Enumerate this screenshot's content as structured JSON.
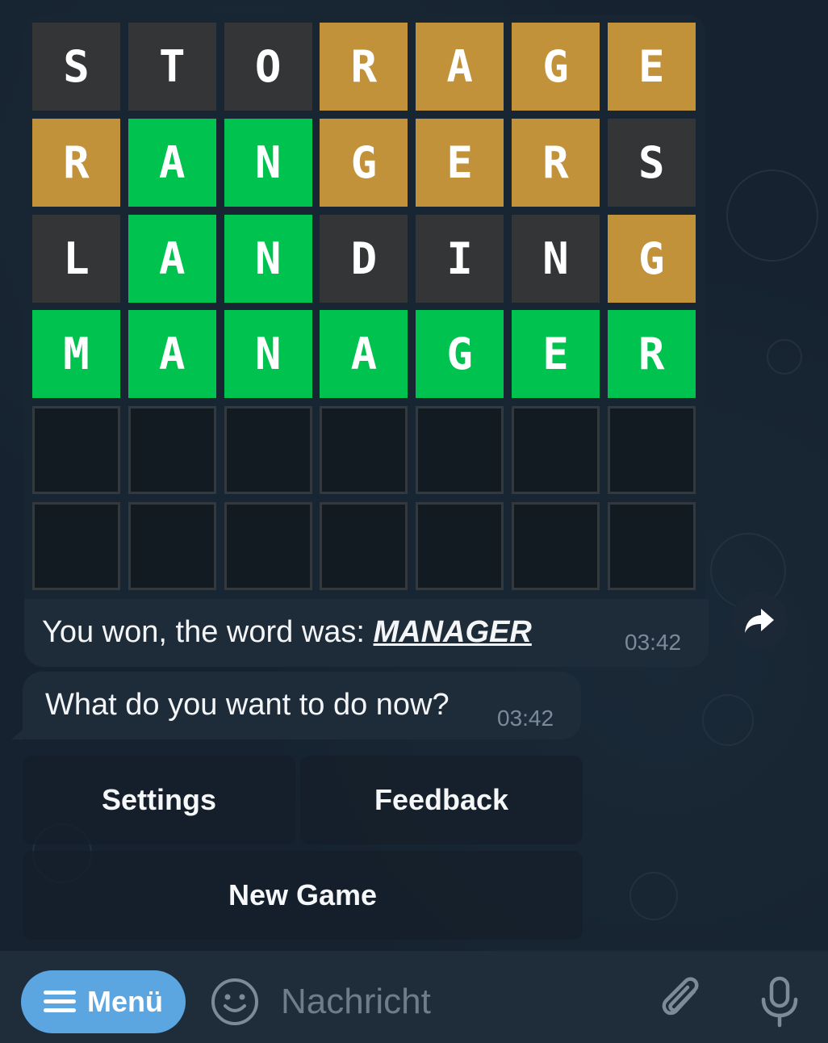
{
  "board": {
    "rows": [
      [
        {
          "l": "S",
          "s": "absent"
        },
        {
          "l": "T",
          "s": "absent"
        },
        {
          "l": "O",
          "s": "absent"
        },
        {
          "l": "R",
          "s": "present"
        },
        {
          "l": "A",
          "s": "present"
        },
        {
          "l": "G",
          "s": "present"
        },
        {
          "l": "E",
          "s": "present"
        }
      ],
      [
        {
          "l": "R",
          "s": "present"
        },
        {
          "l": "A",
          "s": "correct"
        },
        {
          "l": "N",
          "s": "correct"
        },
        {
          "l": "G",
          "s": "present"
        },
        {
          "l": "E",
          "s": "present"
        },
        {
          "l": "R",
          "s": "present"
        },
        {
          "l": "S",
          "s": "absent"
        }
      ],
      [
        {
          "l": "L",
          "s": "absent"
        },
        {
          "l": "A",
          "s": "correct"
        },
        {
          "l": "N",
          "s": "correct"
        },
        {
          "l": "D",
          "s": "absent"
        },
        {
          "l": "I",
          "s": "absent"
        },
        {
          "l": "N",
          "s": "absent"
        },
        {
          "l": "G",
          "s": "present"
        }
      ],
      [
        {
          "l": "M",
          "s": "correct"
        },
        {
          "l": "A",
          "s": "correct"
        },
        {
          "l": "N",
          "s": "correct"
        },
        {
          "l": "A",
          "s": "correct"
        },
        {
          "l": "G",
          "s": "correct"
        },
        {
          "l": "E",
          "s": "correct"
        },
        {
          "l": "R",
          "s": "correct"
        }
      ],
      [
        {
          "l": "",
          "s": "empty"
        },
        {
          "l": "",
          "s": "empty"
        },
        {
          "l": "",
          "s": "empty"
        },
        {
          "l": "",
          "s": "empty"
        },
        {
          "l": "",
          "s": "empty"
        },
        {
          "l": "",
          "s": "empty"
        },
        {
          "l": "",
          "s": "empty"
        }
      ],
      [
        {
          "l": "",
          "s": "empty"
        },
        {
          "l": "",
          "s": "empty"
        },
        {
          "l": "",
          "s": "empty"
        },
        {
          "l": "",
          "s": "empty"
        },
        {
          "l": "",
          "s": "empty"
        },
        {
          "l": "",
          "s": "empty"
        },
        {
          "l": "",
          "s": "empty"
        }
      ]
    ],
    "colors": {
      "absent": "#333537",
      "present": "#c2923b",
      "correct": "#00c24f",
      "empty_border": "#34393e"
    }
  },
  "messages": [
    {
      "prefix": "You won, the word was: ",
      "link": "MANAGER",
      "time": "03:42"
    },
    {
      "text": "What do you want to do now?",
      "time": "03:42"
    }
  ],
  "share_icon": "share-arrow-icon",
  "keyboard": {
    "settings": "Settings",
    "feedback": "Feedback",
    "new_game": "New Game"
  },
  "input_bar": {
    "menu_label": "Menü",
    "placeholder": "Nachricht",
    "icons": [
      "emoji-icon",
      "attach-icon",
      "microphone-icon"
    ],
    "menu_color": "#5ba6e1"
  }
}
